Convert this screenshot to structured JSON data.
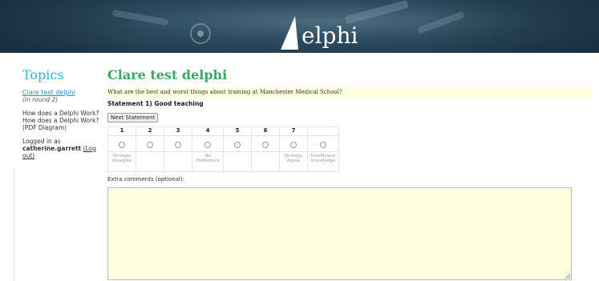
{
  "banner": {
    "logo_text": "elphi"
  },
  "sidebar": {
    "title": "Topics",
    "items": [
      {
        "label": "Clare test delphi",
        "note": "(in round 2)"
      },
      {
        "label": "How does a Delphi Work?"
      },
      {
        "label": "How does a Delphi Work? (PDF Diagram)"
      }
    ],
    "login": {
      "prefix": "Logged in as",
      "user": "catherine.garrett",
      "logout": "(Log out)"
    }
  },
  "main": {
    "title": "Clare test delphi",
    "question": "What are the best and worst things about training at Manchester Medical School?",
    "statement": "Statement 1) Good teaching",
    "next_button": "Next Statement",
    "scale": {
      "numbers": [
        "1",
        "2",
        "3",
        "4",
        "5",
        "6",
        "7",
        ""
      ],
      "labels": [
        "Strongly disagree",
        "",
        "",
        "No Preference",
        "",
        "",
        "Strongly Agree",
        "Insufficient Knowledge"
      ]
    },
    "extra_label": "Extra comments (optional):",
    "comments_value": ""
  },
  "colors": {
    "topics_heading": "#3ab0d0",
    "main_heading": "#3aa860",
    "highlight": "#ffffe0",
    "banner": "#2c4a5e"
  }
}
